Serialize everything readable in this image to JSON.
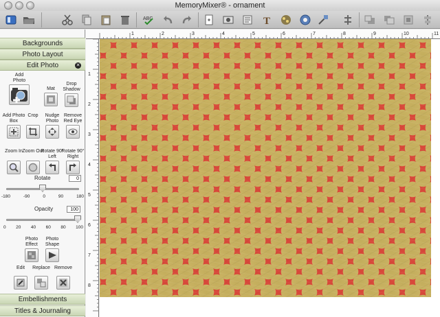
{
  "window": {
    "title": "MemoryMixer® - ornament"
  },
  "toolbar": {
    "icons": [
      "sidebar-toggle-icon",
      "open-folder-icon",
      "cut-icon",
      "copy-icon",
      "paste-icon",
      "delete-icon",
      "spellcheck-icon",
      "undo-icon",
      "redo-icon",
      "new-page-icon",
      "photo-icon",
      "text-icon",
      "type-T-icon",
      "paint-icon",
      "stamp-icon",
      "align-icon",
      "bring-front-icon",
      "send-back-icon",
      "group-icon",
      "distribute-icon"
    ]
  },
  "sidebar": {
    "sections": {
      "backgrounds": "Backgrounds",
      "photo_layout": "Photo Layout",
      "edit_photo": "Edit Photo",
      "embellishments": "Embellishments",
      "titles_journaling": "Titles & Journaling"
    },
    "tools": {
      "add_photo": "Add Photo",
      "mat": "Mat",
      "drop_shadow": "Drop Shadow",
      "add_photo_box": "Add Photo Box",
      "crop": "Crop",
      "nudge_photo": "Nudge Photo",
      "remove_red_eye": "Remove Red Eye",
      "zoom_in": "Zoom In",
      "zoom_out": "Zoom Out",
      "rotate_left": "Rotate 90° Left",
      "rotate_right": "Rotate 90° Right",
      "photo_effect": "Photo Effect",
      "photo_shape": "Photo Shape",
      "edit": "Edit",
      "replace": "Replace",
      "remove": "Remove"
    },
    "rotate": {
      "label": "Rotate",
      "value": "0",
      "ticks": [
        "-180",
        "-90",
        "0",
        "90",
        "180"
      ]
    },
    "opacity": {
      "label": "Opacity",
      "value": "100",
      "ticks": [
        "0",
        "20",
        "40",
        "60",
        "80",
        "100"
      ]
    }
  },
  "ruler": {
    "top": [
      "1",
      "2",
      "3",
      "4",
      "5",
      "6",
      "7",
      "8",
      "9",
      "10",
      "11"
    ],
    "left": [
      "1",
      "2",
      "3",
      "4",
      "5",
      "6",
      "7",
      "8"
    ]
  },
  "colors": {
    "paper_red": "#d8493a",
    "dot_gold": "#c9b262",
    "header_green": "#c9d6b4"
  }
}
